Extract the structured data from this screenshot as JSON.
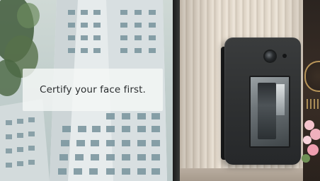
{
  "display": {
    "message": "Certify your face first."
  },
  "terminal": {
    "camera": "camera-lens-icon",
    "screen_state": "idle"
  },
  "colors": {
    "display_sky": "#c7d3d1",
    "building": "#e9eef0",
    "window": "#6f8c95",
    "wall": "#e2d8ca",
    "terminal_body": "#2f3132",
    "gold": "#b8955a",
    "flower": "#f2b9c4"
  }
}
